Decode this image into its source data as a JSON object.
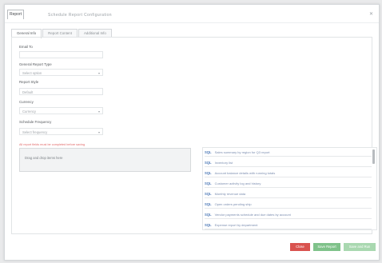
{
  "dialog": {
    "title_tab": "Report",
    "title_text": "Schedule Report Configuration",
    "close_icon": "close-icon"
  },
  "tabs": [
    {
      "label": "General Info",
      "active": true
    },
    {
      "label": "Report Content",
      "active": false
    },
    {
      "label": "Additional Info",
      "active": false
    }
  ],
  "form": {
    "email_label": "Email To",
    "email_value": "",
    "type_label": "General Report Type",
    "type_value": "Select option",
    "style_label": "Report Style",
    "style_value": "Default",
    "currency_label": "Currency",
    "currency_value": "Currency",
    "schedule_label": "Schedule Frequency",
    "schedule_value": "Select frequency",
    "warning": "All report fields must be completed before saving",
    "notes": "Drag and drop items here"
  },
  "list_items": [
    {
      "tag": "SQL",
      "text": "Sales summary by region for Q3 report"
    },
    {
      "tag": "SQL",
      "text": "Inventory list"
    },
    {
      "tag": "SQL",
      "text": "Account balance details with running totals"
    },
    {
      "tag": "SQL",
      "text": "Customer activity log and history"
    },
    {
      "tag": "SQL",
      "text": "Monthly revenue data"
    },
    {
      "tag": "SQL",
      "text": "Open orders pending ship"
    },
    {
      "tag": "SQL",
      "text": "Vendor payments schedule and due dates by account"
    },
    {
      "tag": "SQL",
      "text": "Expense report by department"
    }
  ],
  "buttons": {
    "cancel": "Close",
    "save": "Save Report",
    "save_run": "Save and Run"
  },
  "colors": {
    "cancel_button": "#d9534f",
    "save_button": "#7fc28a",
    "save_run_button": "#a9d8b0",
    "list_tag": "#4f7ab8"
  }
}
